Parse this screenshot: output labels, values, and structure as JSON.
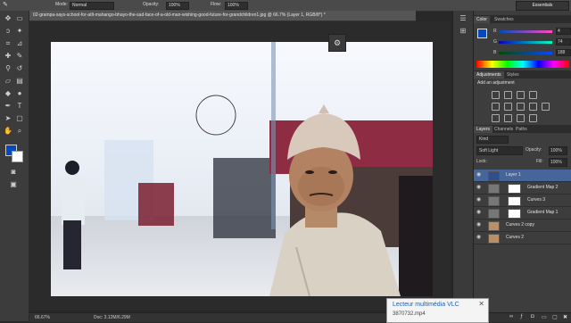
{
  "options_bar": {
    "mode_label": "Mode:",
    "mode_value": "Normal",
    "opacity_label": "Opacity:",
    "opacity_value": "100%",
    "flow_label": "Flow:",
    "flow_value": "100%",
    "workspace": "Essentials"
  },
  "document": {
    "tab_title": "02-grampa-says-school-for-atlt-mahango-bhayo-the-sad-face-of-a-old-man-wishing-good-future-for-grandchildren1.jpg @ 66.7% (Layer 1, RGB/8*) *"
  },
  "status": {
    "zoom": "66.67%",
    "doc_size": "Doc: 3.12M/6.29M"
  },
  "color_panel": {
    "tabs": [
      "Color",
      "Swatches"
    ],
    "r_label": "R",
    "r_value": "4",
    "g_label": "G",
    "g_value": "74",
    "b_label": "B",
    "b_value": "188",
    "fg_color": "#044abc",
    "bg_color": "#ffffff"
  },
  "adjustments_panel": {
    "tabs": [
      "Adjustments",
      "Styles"
    ],
    "heading": "Add an adjustment"
  },
  "layers_panel": {
    "tabs": [
      "Layers",
      "Channels",
      "Paths"
    ],
    "filter_kind": "Kind",
    "blend_mode": "Soft Light",
    "opacity_label": "Opacity:",
    "opacity_value": "100%",
    "lock_label": "Lock:",
    "fill_label": "Fill:",
    "fill_value": "100%",
    "layers": [
      {
        "name": "Layer 1",
        "selected": true
      },
      {
        "name": "Gradient Map 2",
        "selected": false
      },
      {
        "name": "Curves 3",
        "selected": false
      },
      {
        "name": "Gradient Map 1",
        "selected": false
      },
      {
        "name": "Curves 2 copy",
        "selected": false
      },
      {
        "name": "Curves 2",
        "selected": false
      }
    ]
  },
  "vlc_notification": {
    "title": "Lecteur multimédia VLC",
    "filename": "3870732.mp4",
    "close": "✕"
  }
}
